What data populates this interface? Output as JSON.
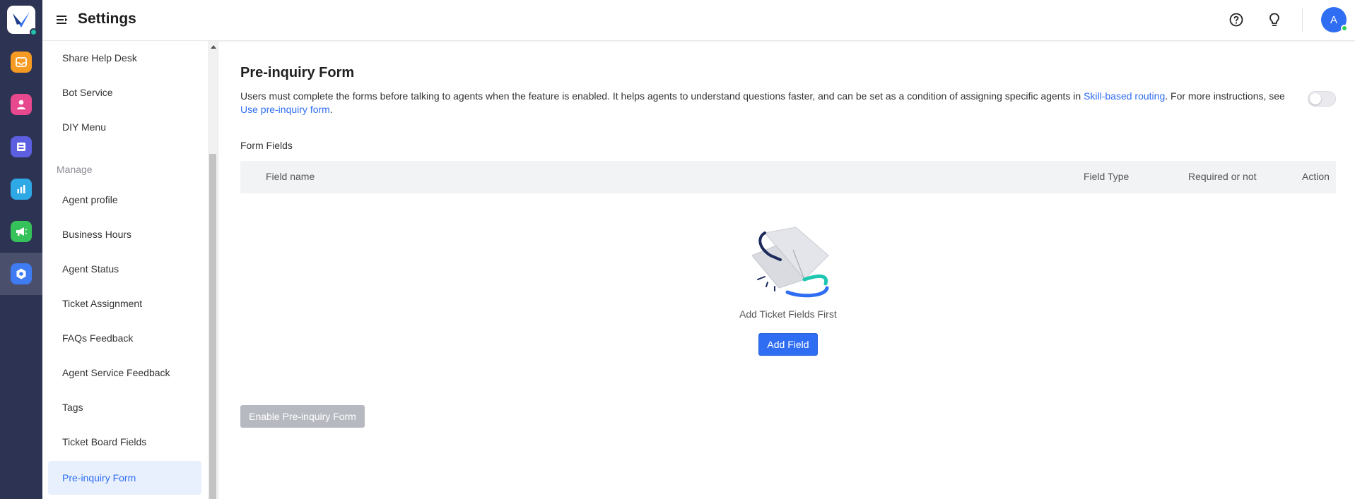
{
  "header": {
    "title": "Settings",
    "avatar_initial": "A"
  },
  "sidebar": {
    "items_top": [
      {
        "label": "Share Help Desk"
      },
      {
        "label": "Bot Service"
      },
      {
        "label": "DIY Menu"
      }
    ],
    "group_manage": "Manage",
    "items_manage": [
      {
        "label": "Agent profile"
      },
      {
        "label": "Business Hours"
      },
      {
        "label": "Agent Status"
      },
      {
        "label": "Ticket Assignment"
      },
      {
        "label": "FAQs Feedback"
      },
      {
        "label": "Agent Service Feedback"
      },
      {
        "label": "Tags"
      },
      {
        "label": "Ticket Board Fields"
      },
      {
        "label": "Pre-inquiry Form"
      }
    ]
  },
  "main": {
    "title": "Pre-inquiry Form",
    "description_part1": "Users must complete the forms before talking to agents when the feature is enabled. It helps agents to understand questions faster, and can be set as a condition of assigning specific agents in ",
    "link_skill_routing": "Skill-based routing",
    "description_part2": ". For more instructions, see ",
    "link_instructions": "Use pre-inquiry form",
    "description_part3": ".",
    "toggle_enabled": false,
    "section_label": "Form Fields",
    "columns": {
      "field_name": "Field name",
      "field_type": "Field Type",
      "required": "Required or not",
      "action": "Action"
    },
    "empty_text": "Add Ticket Fields First",
    "add_field_label": "Add Field",
    "enable_label": "Enable Pre-inquiry Form"
  },
  "colors": {
    "accent": "#2f6ef2",
    "rail_bg": "#2d3352",
    "active_item_bg": "#e8effd",
    "disabled_button": "#b7b9c0"
  }
}
